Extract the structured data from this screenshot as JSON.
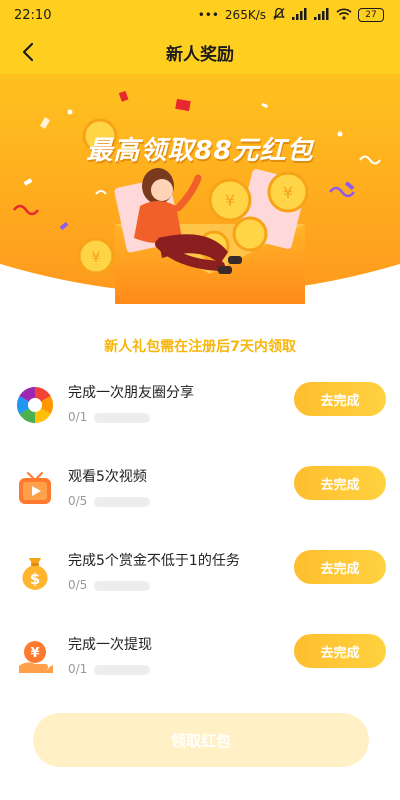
{
  "status_bar": {
    "time": "22:10",
    "network_speed": "265K/s",
    "battery": "27"
  },
  "nav": {
    "title": "新人奖励"
  },
  "banner": {
    "headline": "最高领取88元红包"
  },
  "notice": "新人礼包需在注册后7天内领取",
  "tasks": [
    {
      "title": "完成一次朋友圈分享",
      "count": "0/1",
      "progress": 0,
      "button": "去完成",
      "icon": "camera-aperture-icon"
    },
    {
      "title": "观看5次视频",
      "count": "0/5",
      "progress": 0,
      "button": "去完成",
      "icon": "video-play-icon"
    },
    {
      "title": "完成5个赏金不低于1的任务",
      "count": "0/5",
      "progress": 0,
      "button": "去完成",
      "icon": "money-bag-icon"
    },
    {
      "title": "完成一次提现",
      "count": "0/1",
      "progress": 0,
      "button": "去完成",
      "icon": "yuan-coin-hand-icon"
    }
  ],
  "claim_button": "领取红包",
  "colors": {
    "brand_yellow": "#FFCF1F",
    "button_gradient_start": "#FFBE2E",
    "button_gradient_end": "#FFD240",
    "notice_text": "#F8B50A",
    "claim_disabled": "#FFF0C6"
  }
}
